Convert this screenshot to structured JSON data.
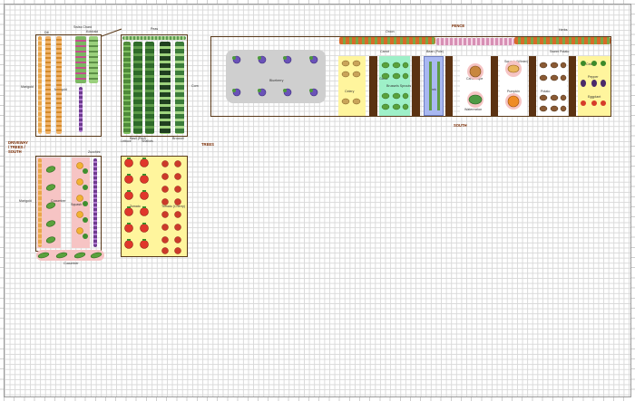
{
  "labels": {
    "fence": "FENCE",
    "south": "SOUTH",
    "driveway": "DRIVEWAY\n/ TREES /\nSOUTH",
    "trees": "TREES",
    "marigold_left_top": "Marigold",
    "marigold_left_bottom": "Marigold",
    "dill": "Dill",
    "marigold_strip": "Marigold",
    "swiss_chard": "Swiss Chard",
    "kohlrabi": "Kohlrabi",
    "peas": "Peas",
    "kale": "Kale",
    "lettuce": "Lettuce",
    "basil_red": "Basil (Red)",
    "shallots": "Shallots",
    "broccoli": "Broccoli",
    "zucchini": "Zucchini",
    "cucumber": "Cucumber",
    "squash": "Squash",
    "cucumber_bottom": "Cucumber",
    "tomato_1": "Tomato",
    "tomato_2": "Tomato (Cherry)",
    "blueberry": "Blueberry",
    "corn": "Corn",
    "onion": "Onion",
    "celery_left": "Celery",
    "carrot": "Carrot",
    "garlic": "Garlic",
    "bean_pole": "Bean (Pole)",
    "brussels_sprouts": "Brussels Sprouts",
    "leek": "Leek",
    "cantaloupe": "Cantaloupe",
    "watermelon": "Watermelon",
    "squash_winter": "Squash (Winter)",
    "pumpkin": "Pumpkin",
    "potato": "Potato",
    "sweet_potato": "Sweet Potato",
    "celery_right": "Celery",
    "eggplant": "Eggplant",
    "pepper": "Pepper",
    "herbs": "Herbs"
  },
  "colors": {
    "grid": "#d9d9d9",
    "bed_border": "#5a3a1a",
    "soil": "#5b3212",
    "yellow_bed": "#fff59d",
    "mint_bed": "#9ef0c8",
    "pink_bed": "#f4b9b9",
    "blue_bed": "#a9b8f2",
    "blueberry_zone": "#cfcfcf",
    "label_dark": "#7a2a00"
  },
  "icons": [
    "blueberry-icon",
    "pea-icon",
    "kale-icon",
    "tomato-icon",
    "squash-icon",
    "cucumber-icon",
    "carrot-icon",
    "onion-icon",
    "pumpkin-icon",
    "melon-icon",
    "potato-icon",
    "leaf-icon"
  ]
}
